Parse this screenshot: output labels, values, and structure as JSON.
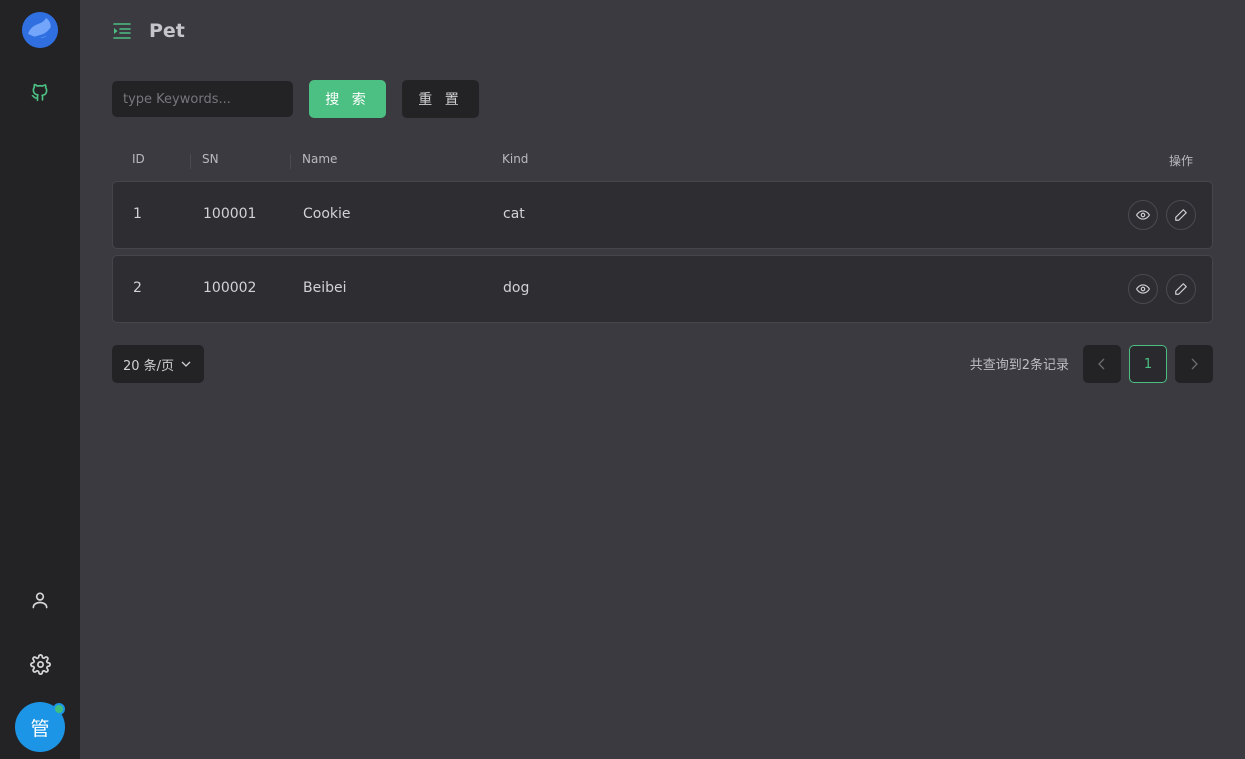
{
  "header": {
    "title": "Pet"
  },
  "search": {
    "placeholder": "type Keywords...",
    "value": ""
  },
  "buttons": {
    "search_label": "搜 索",
    "reset_label": "重 置"
  },
  "table": {
    "columns": [
      "ID",
      "SN",
      "Name",
      "Kind",
      "操作"
    ],
    "rows": [
      {
        "id": "1",
        "sn": "100001",
        "name": "Cookie",
        "kind": "cat"
      },
      {
        "id": "2",
        "sn": "100002",
        "name": "Beibei",
        "kind": "dog"
      }
    ]
  },
  "pagination": {
    "page_size": "20 条/页",
    "total": "共查询到2条记录",
    "current_page": "1"
  },
  "user": {
    "avatar_text": "管"
  },
  "colors": {
    "accent": "#4cbf82",
    "avatar": "#1d95e6",
    "logo": "#2f6fe0"
  }
}
